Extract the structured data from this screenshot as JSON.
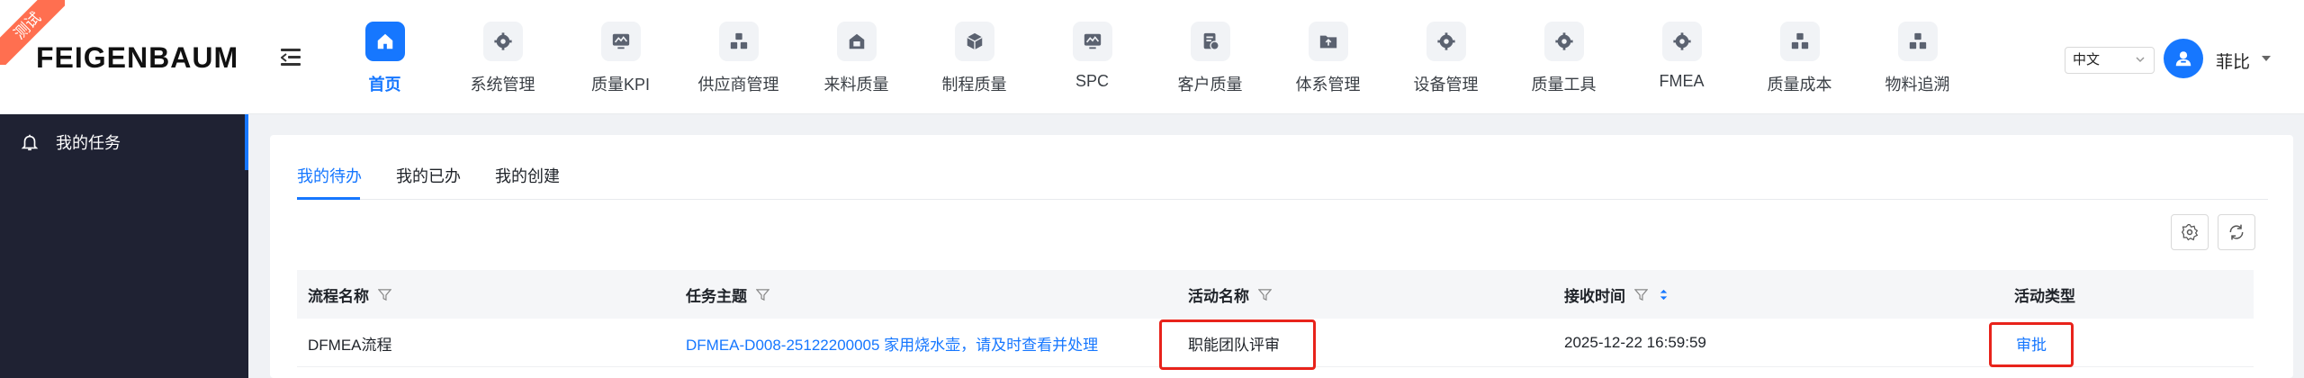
{
  "env_badge": "测试",
  "brand": {
    "logo_text": "FEIGENBAUM"
  },
  "nav": {
    "items": [
      {
        "label": "首页",
        "icon": "home-icon",
        "active": true
      },
      {
        "label": "系统管理",
        "icon": "gear-icon"
      },
      {
        "label": "质量KPI",
        "icon": "monitor-chart-icon"
      },
      {
        "label": "供应商管理",
        "icon": "cubes-icon"
      },
      {
        "label": "来料质量",
        "icon": "inbox-box-icon"
      },
      {
        "label": "制程质量",
        "icon": "box-icon"
      },
      {
        "label": "SPC",
        "icon": "monitor-chart-icon"
      },
      {
        "label": "客户质量",
        "icon": "document-clock-icon"
      },
      {
        "label": "体系管理",
        "icon": "folder-up-icon"
      },
      {
        "label": "设备管理",
        "icon": "gear-icon"
      },
      {
        "label": "质量工具",
        "icon": "gear-icon"
      },
      {
        "label": "FMEA",
        "icon": "gear-icon"
      },
      {
        "label": "质量成本",
        "icon": "cubes-icon"
      },
      {
        "label": "物料追溯",
        "icon": "cubes-icon"
      }
    ]
  },
  "header": {
    "language": "中文",
    "user_name": "菲比"
  },
  "sidebar": {
    "items": [
      {
        "label": "我的任务",
        "icon": "bell-icon",
        "active": true
      }
    ]
  },
  "tabs": [
    {
      "label": "我的待办",
      "active": true
    },
    {
      "label": "我的已办"
    },
    {
      "label": "我的创建"
    }
  ],
  "table": {
    "columns": [
      "流程名称",
      "任务主题",
      "活动名称",
      "接收时间",
      "活动类型"
    ],
    "rows": [
      {
        "process": "DFMEA流程",
        "subject": "DFMEA-D008-25122200005 家用烧水壶，请及时查看并处理",
        "activity": "职能团队评审",
        "received": "2025-12-22 16:59:59",
        "type": "审批"
      }
    ]
  },
  "colors": {
    "accent": "#1677ff",
    "sidebar_bg": "#1f2233",
    "highlight": "#e8231b",
    "badge": "#ff6f50"
  }
}
